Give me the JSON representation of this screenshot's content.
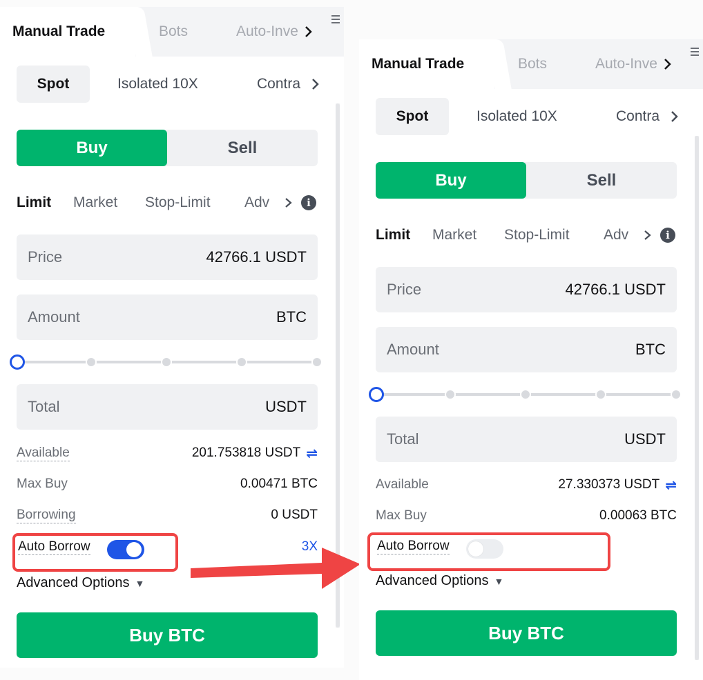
{
  "panels": [
    {
      "tabs": {
        "active": "Manual Trade",
        "bots": "Bots",
        "auto_invest": "Auto-Inve"
      },
      "subtabs": {
        "spot": "Spot",
        "isolated": "Isolated 10X",
        "contract": "Contra"
      },
      "side": {
        "buy": "Buy",
        "sell": "Sell"
      },
      "order_types": {
        "limit": "Limit",
        "market": "Market",
        "stop_limit": "Stop-Limit",
        "advanced": "Adv"
      },
      "price": {
        "label": "Price",
        "value": "42766.1 USDT"
      },
      "amount": {
        "label": "Amount",
        "unit": "BTC"
      },
      "slider_position": 0,
      "total": {
        "label": "Total",
        "unit": "USDT"
      },
      "available": {
        "label": "Available",
        "value": "201.753818 USDT"
      },
      "max_buy": {
        "label": "Max Buy",
        "value": "0.00471 BTC"
      },
      "borrowing": {
        "label": "Borrowing",
        "value": "0 USDT"
      },
      "auto_borrow": {
        "label": "Auto Borrow",
        "enabled": true,
        "multiplier": "3X"
      },
      "advanced_options": "Advanced Options",
      "submit": "Buy BTC"
    },
    {
      "tabs": {
        "active": "Manual Trade",
        "bots": "Bots",
        "auto_invest": "Auto-Inve"
      },
      "subtabs": {
        "spot": "Spot",
        "isolated": "Isolated 10X",
        "contract": "Contra"
      },
      "side": {
        "buy": "Buy",
        "sell": "Sell"
      },
      "order_types": {
        "limit": "Limit",
        "market": "Market",
        "stop_limit": "Stop-Limit",
        "advanced": "Adv"
      },
      "price": {
        "label": "Price",
        "value": "42766.1 USDT"
      },
      "amount": {
        "label": "Amount",
        "unit": "BTC"
      },
      "slider_position": 0,
      "total": {
        "label": "Total",
        "unit": "USDT"
      },
      "available": {
        "label": "Available",
        "value": "27.330373 USDT"
      },
      "max_buy": {
        "label": "Max Buy",
        "value": "0.00063 BTC"
      },
      "auto_borrow": {
        "label": "Auto Borrow",
        "enabled": false
      },
      "advanced_options": "Advanced Options",
      "submit": "Buy BTC"
    }
  ],
  "colors": {
    "buy_green": "#00b46d",
    "accent_blue": "#1f55e6",
    "highlight_red": "#ef4444"
  }
}
